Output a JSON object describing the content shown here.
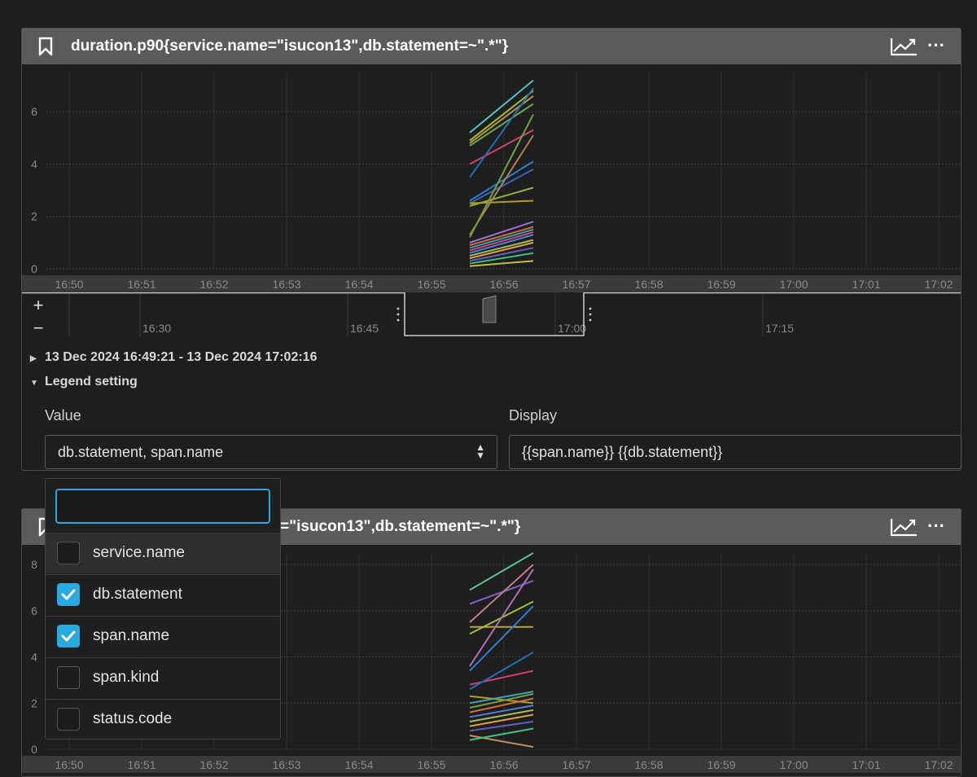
{
  "panels": [
    {
      "title": "duration.p90{service.name=\"isucon13\",db.statement=~\".*\"}",
      "y_ticks": [
        "0",
        "2",
        "4",
        "6"
      ],
      "x_ticks": [
        "16:50",
        "16:51",
        "16:52",
        "16:53",
        "16:54",
        "16:55",
        "16:56",
        "16:57",
        "16:58",
        "16:59",
        "17:00",
        "17:01",
        "17:02"
      ],
      "navigator_ticks": [
        "16:30",
        "16:45",
        "17:00",
        "17:15"
      ],
      "time_range": "13 Dec 2024 16:49:21 - 13 Dec 2024 17:02:16",
      "legend_setting": {
        "title": "Legend setting",
        "value_label": "Value",
        "value_selected": "db.statement, span.name",
        "display_label": "Display",
        "display_value": "{{span.name}} {{db.statement}}"
      },
      "zoom_in": "+",
      "zoom_out": "−"
    },
    {
      "title_visible": "=\"isucon13\",db.statement=~\".*\"}",
      "y_ticks": [
        "0",
        "2",
        "4",
        "6",
        "8"
      ],
      "x_ticks": [
        "16:50",
        "16:51",
        "16:52",
        "16:53",
        "16:54",
        "16:55",
        "16:56",
        "16:57",
        "16:58",
        "16:59",
        "17:00",
        "17:01",
        "17:02"
      ]
    }
  ],
  "dropdown": {
    "search_value": "",
    "options": [
      {
        "label": "service.name",
        "checked": false
      },
      {
        "label": "db.statement",
        "checked": true
      },
      {
        "label": "span.name",
        "checked": true
      },
      {
        "label": "span.kind",
        "checked": false
      },
      {
        "label": "status.code",
        "checked": false
      }
    ]
  },
  "colors": {
    "accent": "#2aa9e0",
    "header_bg": "#5b5b5b",
    "page_bg": "#1e1e1e"
  },
  "chart_data": [
    {
      "type": "line",
      "x": [
        "16:55",
        "16:56"
      ],
      "ylim": [
        0,
        7.5
      ],
      "series": [
        {
          "values": [
            5.2,
            7.2
          ],
          "color": "#5bc0c0"
        },
        {
          "values": [
            4.9,
            6.8
          ],
          "color": "#9ac03a"
        },
        {
          "values": [
            4.8,
            6.6
          ],
          "color": "#c09040"
        },
        {
          "values": [
            4.7,
            6.3
          ],
          "color": "#6aa84f"
        },
        {
          "values": [
            4.0,
            5.3
          ],
          "color": "#d04070"
        },
        {
          "values": [
            3.5,
            6.9
          ],
          "color": "#1f6fb4"
        },
        {
          "values": [
            2.6,
            4.1
          ],
          "color": "#2a7fd4"
        },
        {
          "values": [
            2.5,
            3.8
          ],
          "color": "#3a60c0"
        },
        {
          "values": [
            2.4,
            3.1
          ],
          "color": "#8cb04a"
        },
        {
          "values": [
            2.5,
            2.6
          ],
          "color": "#b0a020"
        },
        {
          "values": [
            1.3,
            5.1
          ],
          "color": "#b08050"
        },
        {
          "values": [
            1.2,
            5.9
          ],
          "color": "#70a040"
        },
        {
          "values": [
            1.0,
            1.8
          ],
          "color": "#9a70d0"
        },
        {
          "values": [
            0.9,
            1.6
          ],
          "color": "#d07040"
        },
        {
          "values": [
            0.8,
            1.5
          ],
          "color": "#40a0b0"
        },
        {
          "values": [
            0.7,
            1.4
          ],
          "color": "#c05080"
        },
        {
          "values": [
            0.6,
            1.3
          ],
          "color": "#5080d0"
        },
        {
          "values": [
            0.5,
            1.1
          ],
          "color": "#a0c060"
        },
        {
          "values": [
            0.4,
            1.0
          ],
          "color": "#e0a040"
        },
        {
          "values": [
            0.3,
            0.8
          ],
          "color": "#6060c0"
        },
        {
          "values": [
            0.2,
            0.6
          ],
          "color": "#40c080"
        },
        {
          "values": [
            0.1,
            0.3
          ],
          "color": "#c0c040"
        }
      ]
    },
    {
      "type": "line",
      "x": [
        "16:55",
        "16:56"
      ],
      "ylim": [
        0,
        8.5
      ],
      "series": [
        {
          "values": [
            6.9,
            8.5
          ],
          "color": "#5bc090"
        },
        {
          "values": [
            6.3,
            7.3
          ],
          "color": "#7a60c0"
        },
        {
          "values": [
            5.5,
            8.0
          ],
          "color": "#c08080"
        },
        {
          "values": [
            5.3,
            5.3
          ],
          "color": "#c0a030"
        },
        {
          "values": [
            5.0,
            6.4
          ],
          "color": "#9ac03a"
        },
        {
          "values": [
            3.6,
            7.8
          ],
          "color": "#b070b0"
        },
        {
          "values": [
            3.4,
            6.2
          ],
          "color": "#2a7fd4"
        },
        {
          "values": [
            2.8,
            3.4
          ],
          "color": "#d04070"
        },
        {
          "values": [
            2.6,
            4.2
          ],
          "color": "#1f6fb4"
        },
        {
          "values": [
            2.3,
            2.0
          ],
          "color": "#b0a020"
        },
        {
          "values": [
            2.0,
            2.5
          ],
          "color": "#40a0b0"
        },
        {
          "values": [
            1.8,
            2.4
          ],
          "color": "#70a040"
        },
        {
          "values": [
            1.6,
            2.2
          ],
          "color": "#d07040"
        },
        {
          "values": [
            1.4,
            1.9
          ],
          "color": "#5080d0"
        },
        {
          "values": [
            1.2,
            1.7
          ],
          "color": "#a0c060"
        },
        {
          "values": [
            1.0,
            1.5
          ],
          "color": "#e0a040"
        },
        {
          "values": [
            0.8,
            1.2
          ],
          "color": "#6060c0"
        },
        {
          "values": [
            0.6,
            0.1
          ],
          "color": "#c09060"
        },
        {
          "values": [
            0.4,
            0.9
          ],
          "color": "#40c080"
        }
      ]
    }
  ]
}
